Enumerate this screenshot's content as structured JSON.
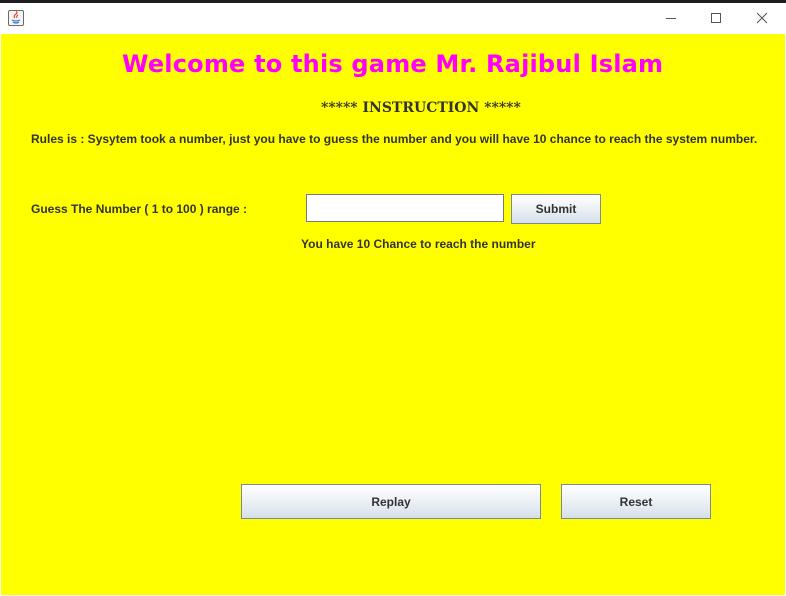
{
  "window": {
    "icon": "java-app-icon",
    "controls": [
      "minimize-icon",
      "maximize-icon",
      "close-icon"
    ]
  },
  "colors": {
    "background": "#ffff00",
    "title": "#ff00ff",
    "text": "#333333"
  },
  "main": {
    "welcome": "Welcome to this game Mr. Rajibul Islam",
    "instruction": "***** INSTRUCTION *****",
    "rules": "Rules is : Sysytem took a number, just you have to guess the number and you will have 10 chance to reach the system number.",
    "guess_label": "Guess The Number ( 1 to 100 ) range :",
    "guess_value": "",
    "submit_label": "Submit",
    "chance_text": "You have 10 Chance to reach the number",
    "replay_label": "Replay",
    "reset_label": "Reset"
  }
}
